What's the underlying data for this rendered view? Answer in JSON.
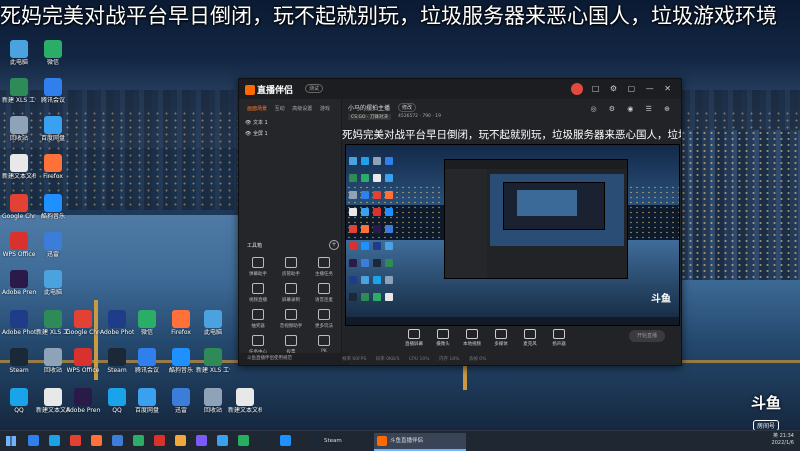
{
  "danmaku": {
    "text": "死妈完美对战平台早日倒闭，玩不起就别玩，垃圾服务器来恶心国人，垃圾游戏环境"
  },
  "desktop_icons": [
    {
      "label": "此电脑",
      "color": "#4aa3df"
    },
    {
      "label": "新建 XLS 工作表",
      "color": "#2e8b57"
    },
    {
      "label": "回收站",
      "color": "#8fa3b8"
    },
    {
      "label": "新建文本文档",
      "color": "#e8e8e8"
    },
    {
      "label": "Google Chrome",
      "color": "#e34133"
    },
    {
      "label": "WPS Office",
      "color": "#d9322e"
    },
    {
      "label": "Adobe Premiere",
      "color": "#2a1a4a"
    },
    {
      "label": "Adobe Photoshop",
      "color": "#1f3c88"
    },
    {
      "label": "Steam",
      "color": "#1b2838"
    },
    {
      "label": "QQ",
      "color": "#1aa3e8"
    },
    {
      "label": "微信",
      "color": "#2aae67"
    },
    {
      "label": "腾讯会议",
      "color": "#2f80ed"
    },
    {
      "label": "百度网盘",
      "color": "#3aa0f0"
    },
    {
      "label": "Firefox",
      "color": "#ff7139"
    },
    {
      "label": "酷狗音乐",
      "color": "#1e90ff"
    },
    {
      "label": "迅雷",
      "color": "#3b7dd8"
    }
  ],
  "app": {
    "name": "直播伴侣",
    "beta_label": "测试",
    "title_icons": "□ ⚙ ▢ — ✕",
    "sidebar": {
      "tabs": [
        "画面场景",
        "互动",
        "高级设置",
        "游戏"
      ],
      "active_tab": "画面场景",
      "scenes": [
        "文本 1",
        "全屏 1"
      ],
      "tools_header": "工具箱",
      "tools_add": "+",
      "tools": [
        "弹幕助手",
        "房管助手",
        "主播任务",
        "视频直播",
        "屏幕录制",
        "语音连麦",
        "抽奖器",
        "音视频助手",
        "更多玩法",
        "任务中心",
        "投票",
        "PK"
      ],
      "notice": "斗鱼直播伴侣使用规范"
    },
    "main": {
      "room_title": "小马的摆拍主播",
      "edit_label": "修改",
      "tag": "CS:GO · 刀锋对决",
      "meta": "4536572 · 790 · 19",
      "top_icons": "◎ ⚙ ◉ ☰ ⊕",
      "scroll_text": "死妈完美对战平台早日倒闭，玩不起就别玩，垃圾服务器来恶心国人，垃圾游戏环境",
      "preview_logo": "斗鱼",
      "controls": [
        "直播屏幕",
        "摄像头",
        "本地视频",
        "多媒体",
        "麦克风",
        "扬声器"
      ],
      "start_live": "开始直播",
      "status": [
        "帧率 60FPS",
        "码率 0KB/S",
        "CPU 10%",
        "内存 18%",
        "丢帧 0%"
      ]
    }
  },
  "watermark": {
    "brand": "斗鱼",
    "room_label": "房间号",
    "room_number": "4536572"
  },
  "taskbar": {
    "apps": [
      {
        "label": "Steam",
        "color": "#1b2838"
      },
      {
        "label": "斗鱼直播伴侣",
        "color": "#ff6a00"
      }
    ],
    "pinned_colors": [
      "#2f80ed",
      "#1aa3e8",
      "#e34133",
      "#ff7139",
      "#3b7dd8",
      "#2aae67",
      "#d9322e",
      "#f2a93b",
      "#7a5af8",
      "#3aa0f0",
      "#27ae60",
      "#1b2838",
      "#1e90ff"
    ],
    "tray_time": "21:34",
    "tray_date": "2022/1/6",
    "tray_lang": "英"
  }
}
